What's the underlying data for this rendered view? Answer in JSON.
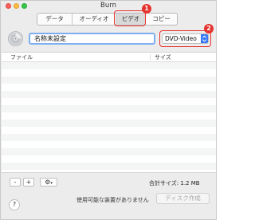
{
  "window": {
    "title": "Burn"
  },
  "tabs": [
    {
      "label": "データ"
    },
    {
      "label": "オーディオ"
    },
    {
      "label": "ビデオ"
    },
    {
      "label": "コピー"
    }
  ],
  "annotations": {
    "badge1": "1",
    "badge2": "2",
    "accent": "#e5322d"
  },
  "disc": {
    "name_value": "名称未設定",
    "format_value": "DVD-Video",
    "icon": "disc-icon"
  },
  "file_list": {
    "columns": [
      "ファイル",
      "サイズ"
    ],
    "rows": []
  },
  "bottom": {
    "remove_label": "-",
    "add_label": "+",
    "gear_label": "⚙",
    "total_size": "合計サイズ: 1.2 MB",
    "help_label": "?",
    "status": "使用可能な装置がありません",
    "burn_button": "ディスク作成"
  }
}
